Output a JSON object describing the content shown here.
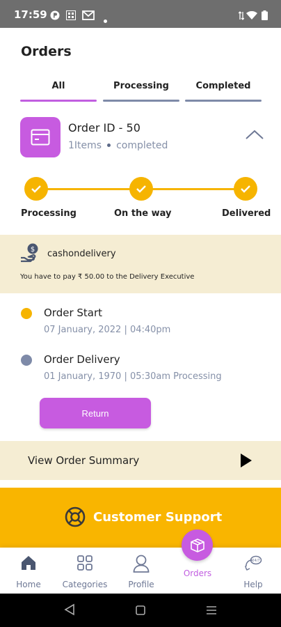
{
  "status_bar": {
    "time": "17:59"
  },
  "header": {
    "title": "Orders"
  },
  "tabs": [
    {
      "label": "All",
      "active": true
    },
    {
      "label": "Processing",
      "active": false
    },
    {
      "label": "Completed",
      "active": false
    }
  ],
  "order": {
    "id_label": "Order ID  -  50",
    "items": "1Items",
    "status": "completed",
    "icon": "order-box-icon"
  },
  "progress": {
    "steps": [
      {
        "label": "Processing"
      },
      {
        "label": "On the way"
      },
      {
        "label": "Delivered"
      }
    ]
  },
  "payment": {
    "method": "cashondelivery",
    "note": "You have to pay ₹ 50.00 to the Delivery Executive"
  },
  "timeline": [
    {
      "title": "Order Start",
      "date": "07 January, 2022  |  04:40pm",
      "color": "#f6b400"
    },
    {
      "title": "Order Delivery",
      "date": "01 January, 1970  |  05:30am Processing",
      "color": "#7e8aa8"
    }
  ],
  "actions": {
    "return_label": "Return"
  },
  "summary": {
    "label": "View Order Summary"
  },
  "support": {
    "label": "Customer Support"
  },
  "bottom_nav": [
    {
      "label": "Home",
      "icon": "home-icon"
    },
    {
      "label": "Categories",
      "icon": "categories-icon"
    },
    {
      "label": "Profile",
      "icon": "profile-icon"
    },
    {
      "label": "Orders",
      "icon": "orders-box-icon",
      "active": true
    },
    {
      "label": "Help",
      "icon": "help-chat-icon"
    }
  ],
  "colors": {
    "accent": "#c75be0",
    "progress": "#f6b400",
    "support_banner": "#f9b500",
    "highlight_bg": "#f5edd3"
  }
}
